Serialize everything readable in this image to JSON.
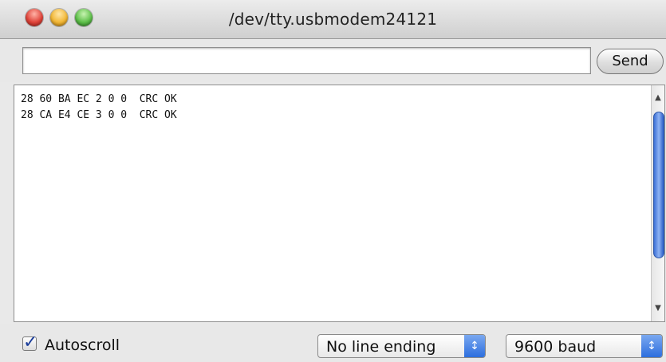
{
  "window": {
    "title": "/dev/tty.usbmodem24121",
    "close_icon": "close-icon",
    "minimize_icon": "minimize-icon",
    "zoom_icon": "zoom-icon"
  },
  "send_row": {
    "input_value": "",
    "send_label": "Send"
  },
  "console": {
    "lines": [
      "28 60 BA EC 2 0 0  CRC OK",
      "28 CA E4 CE 3 0 0  CRC OK"
    ],
    "scroll_up_icon": "▲",
    "scroll_down_icon": "▼"
  },
  "footer": {
    "autoscroll_label": "Autoscroll",
    "autoscroll_checked": true,
    "line_ending": "No line ending",
    "baud": "9600 baud",
    "select_arrows": "↕"
  },
  "colors": {
    "close": "#e0443a",
    "minimize": "#f2b735",
    "zoom": "#5ec04a",
    "accent": "#2d6fde"
  }
}
